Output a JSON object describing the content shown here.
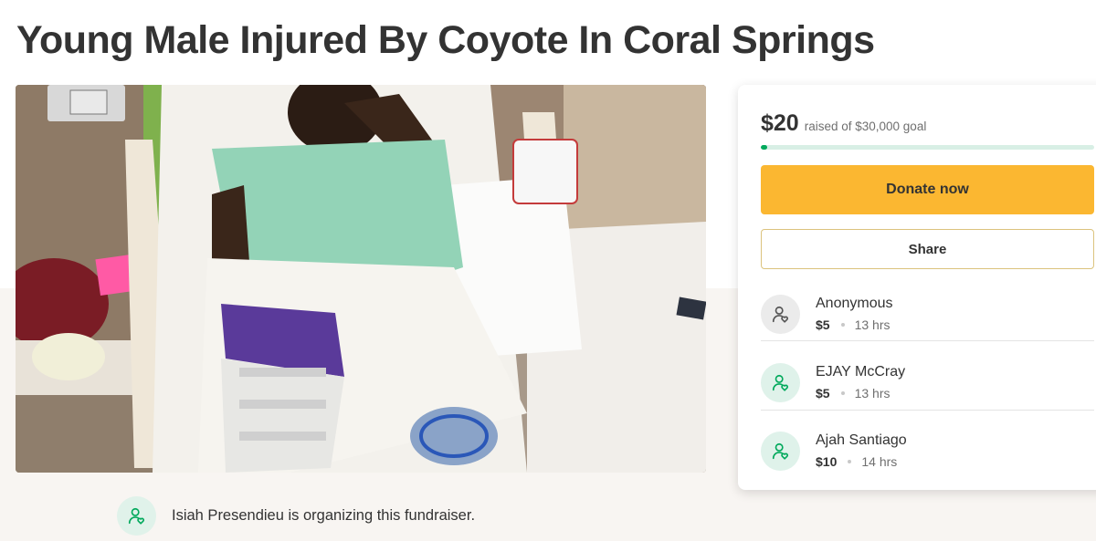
{
  "page": {
    "title": "Young Male Injured By Coyote In Coral Springs"
  },
  "campaign": {
    "raised_amount": "$20",
    "goal_text": "raised of $30,000 goal",
    "progress_fraction": 0.02,
    "donate_label": "Donate now",
    "share_label": "Share"
  },
  "donations": [
    {
      "name": "Anonymous",
      "amount": "$5",
      "time": "13 hrs",
      "avatar": "anonymous-user-icon"
    },
    {
      "name": "EJAY McCray",
      "amount": "$5",
      "time": "13 hrs",
      "avatar": "user-heart-icon"
    },
    {
      "name": "Ajah Santiago",
      "amount": "$10",
      "time": "14 hrs",
      "avatar": "user-heart-icon"
    }
  ],
  "organizer": {
    "text": "Isiah Presendieu is organizing this fundraiser.",
    "avatar": "user-heart-icon"
  },
  "colors": {
    "accent_green": "#02a95c",
    "donate_yellow": "#fbb731",
    "title": "#333333"
  }
}
